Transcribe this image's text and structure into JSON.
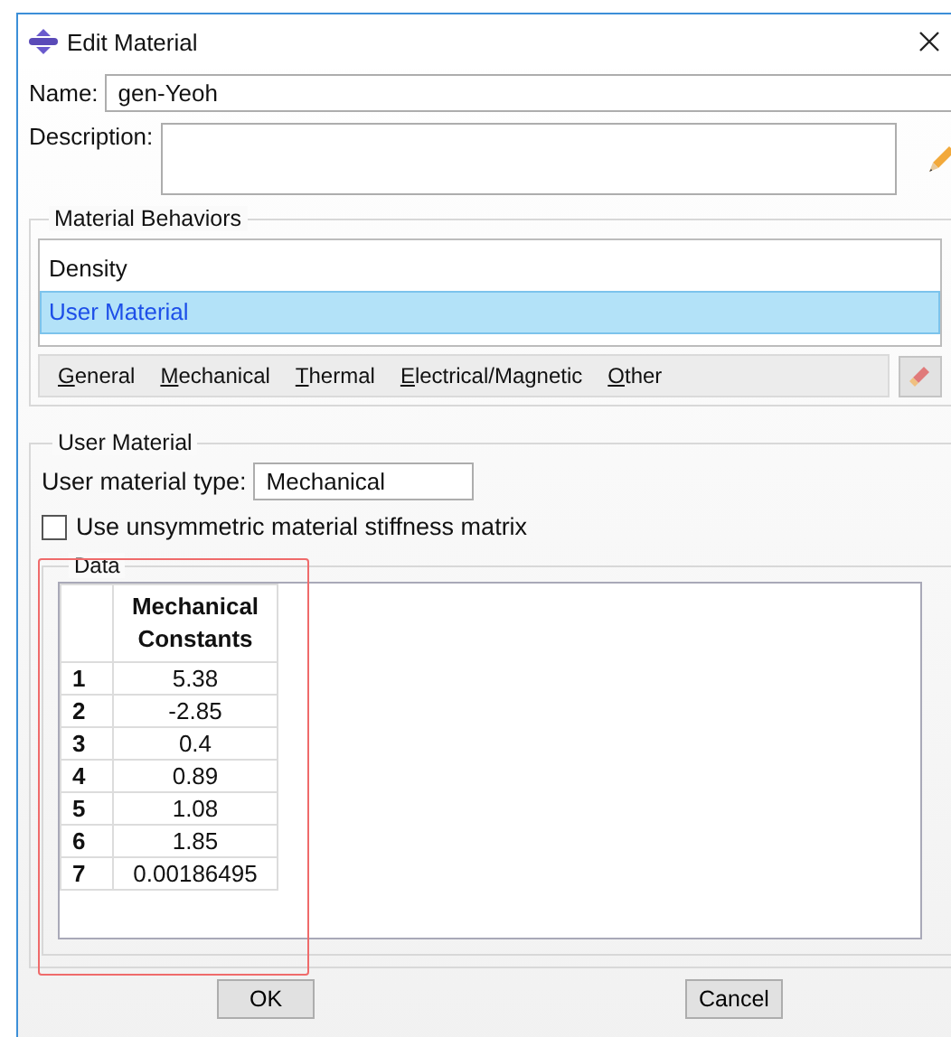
{
  "window": {
    "title": "Edit Material"
  },
  "name": {
    "label": "Name:",
    "value": "gen-Yeoh"
  },
  "description": {
    "label": "Description:"
  },
  "material_behaviors": {
    "title": "Material Behaviors",
    "items": [
      {
        "label": "Density",
        "selected": false
      },
      {
        "label": "User Material",
        "selected": true
      }
    ]
  },
  "menu": [
    "General",
    "Mechanical",
    "Thermal",
    "Electrical/Magnetic",
    "Other"
  ],
  "user_material": {
    "title": "User Material",
    "type_label": "User material type:",
    "type_value": "Mechanical",
    "unsymmetric": {
      "label": "Use unsymmetric material stiffness matrix",
      "checked": false
    }
  },
  "data": {
    "title": "Data",
    "columns": [
      "Mechanical Constants"
    ],
    "rows": [
      {
        "index": "1",
        "value": "5.38"
      },
      {
        "index": "2",
        "value": "-2.85"
      },
      {
        "index": "3",
        "value": "0.4"
      },
      {
        "index": "4",
        "value": "0.89"
      },
      {
        "index": "5",
        "value": "1.08"
      },
      {
        "index": "6",
        "value": "1.85"
      },
      {
        "index": "7",
        "value": "0.00186495"
      }
    ]
  },
  "buttons": [
    "OK",
    "Cancel"
  ]
}
